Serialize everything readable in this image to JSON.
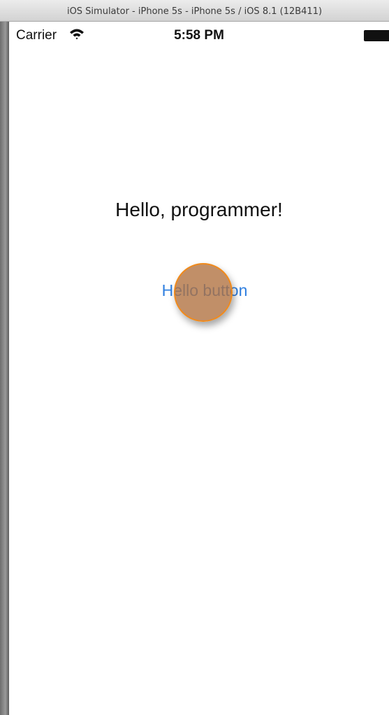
{
  "window": {
    "title": "iOS Simulator - iPhone 5s - iPhone 5s / iOS 8.1 (12B411)"
  },
  "status_bar": {
    "carrier": "Carrier",
    "time": "5:58 PM",
    "icons": [
      "wifi-icon",
      "battery-icon"
    ]
  },
  "main": {
    "label": "Hello, programmer!",
    "button_label": "Hello button"
  },
  "colors": {
    "button_text": "#2f7fe0",
    "touch_indicator_fill": "#b0703e",
    "touch_indicator_border": "#f08a1c"
  }
}
